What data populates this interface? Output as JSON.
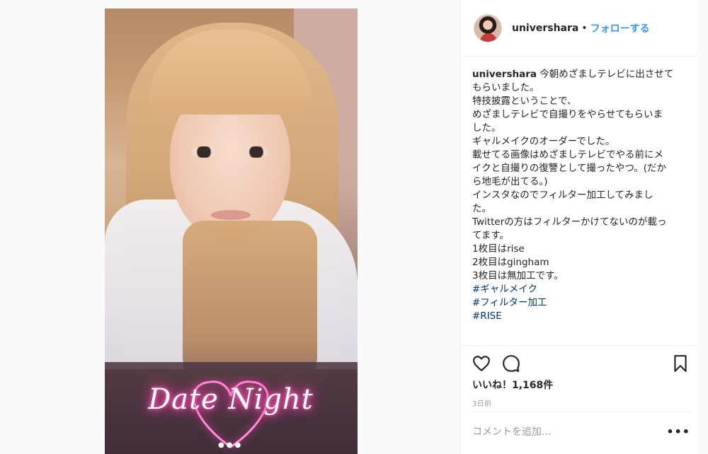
{
  "post": {
    "overlay_text": "Date Night",
    "username": "univershara",
    "follow_label": "フォローする",
    "separator": "•",
    "caption_lines": [
      "今朝めざましテレビに出させて",
      "もらいました。",
      "特技披露ということで、",
      "めざましテレビで自撮りをやらせてもらいま",
      "した。",
      "ギャルメイクのオーダーでした。",
      "",
      "載せてる画像はめざましテレビでやる前にメ",
      "イクと自撮りの復讐として撮ったやつ。(だか",
      "ら地毛が出てる。)",
      "インスタなのでフィルター加工してみまし",
      "た。",
      "Twitterの方はフィルターかけてないのが載っ",
      "てます。",
      "1枚目はrise",
      "2枚目はgingham",
      "3枚目は無加工です。",
      ""
    ],
    "hashtags": [
      "#ギャルメイク",
      "#フィルター加工",
      "#RISE"
    ],
    "likes_label": "いいね！1,168件",
    "time_label": "3日前",
    "comment_placeholder": "コメントを追加...",
    "more_label": "•••"
  },
  "icons": {
    "like": "heart-icon",
    "comment": "comment-bubble-icon",
    "save": "bookmark-icon",
    "more": "more-options-icon"
  },
  "colors": {
    "follow": "#3897f0",
    "hashtag": "#003569",
    "muted": "#999999",
    "border": "#efefef"
  }
}
